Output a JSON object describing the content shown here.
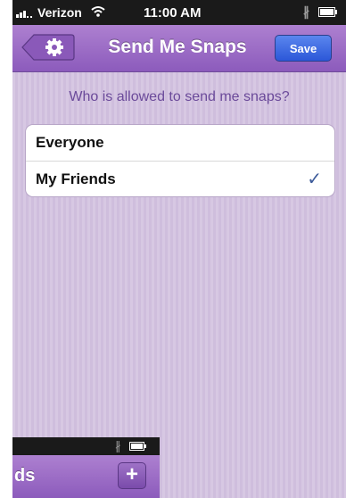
{
  "statusbar": {
    "carrier": "Verizon",
    "time": "11:00 AM",
    "bluetooth": "∦",
    "signal_icon": "signal-bars-icon",
    "wifi_icon": "wifi-icon",
    "battery_icon": "battery-icon"
  },
  "navbar": {
    "title": "Send Me Snaps",
    "back_icon": "gear-icon",
    "save_label": "Save"
  },
  "main": {
    "question": "Who is allowed to send me snaps?",
    "options": [
      {
        "label": "Everyone",
        "selected": false
      },
      {
        "label": "My Friends",
        "selected": true
      }
    ],
    "checkmark": "✓"
  },
  "overlay": {
    "title_fragment": "ds",
    "add_label": "+",
    "bluetooth": "∦"
  },
  "colors": {
    "nav_purple": "#9c6cc8",
    "background_lavender": "#d3c3e0",
    "save_blue": "#3a66e0",
    "question_text": "#6b4a9a",
    "checkmark": "#3d5b9a"
  }
}
